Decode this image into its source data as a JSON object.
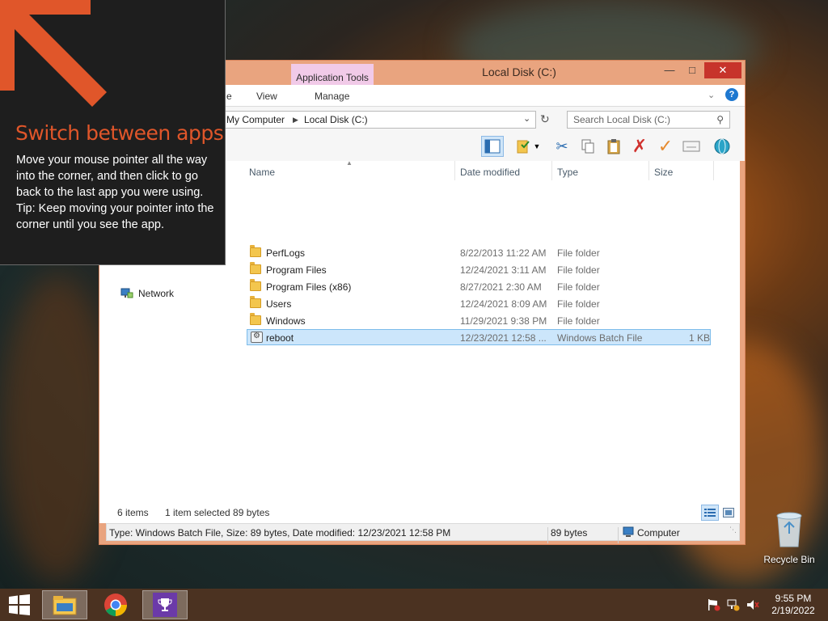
{
  "window": {
    "title": "Local Disk (C:)",
    "contextual_tab": "Application Tools",
    "ribbon_tabs": [
      "e",
      "View",
      "Manage"
    ],
    "breadcrumb": [
      "My Computer",
      "Local Disk (C:)"
    ],
    "search_placeholder": "Search Local Disk (C:)"
  },
  "columns": [
    "Name",
    "Date modified",
    "Type",
    "Size"
  ],
  "files": [
    {
      "name": "PerfLogs",
      "date": "8/22/2013 11:22 AM",
      "type": "File folder",
      "size": "",
      "icon": "folder-icon"
    },
    {
      "name": "Program Files",
      "date": "12/24/2021 3:11 AM",
      "type": "File folder",
      "size": "",
      "icon": "folder-icon"
    },
    {
      "name": "Program Files (x86)",
      "date": "8/27/2021 2:30 AM",
      "type": "File folder",
      "size": "",
      "icon": "folder-icon"
    },
    {
      "name": "Users",
      "date": "12/24/2021 8:09 AM",
      "type": "File folder",
      "size": "",
      "icon": "folder-icon"
    },
    {
      "name": "Windows",
      "date": "11/29/2021 9:38 PM",
      "type": "File folder",
      "size": "",
      "icon": "folder-icon"
    },
    {
      "name": "reboot",
      "date": "12/23/2021 12:58 ...",
      "type": "Windows Batch File",
      "size": "1 KB",
      "icon": "batch-file-icon",
      "selected": true
    }
  ],
  "nav": {
    "network": "Network"
  },
  "status": {
    "items": "6 items",
    "selected": "1 item selected  89 bytes",
    "detail": "Type: Windows Batch File, Size: 89 bytes, Date modified: 12/23/2021 12:58 PM",
    "size": "89 bytes",
    "location": "Computer"
  },
  "tip": {
    "title": "Switch between apps",
    "line1": "Move your mouse pointer all the way into the corner, and then click to go back to the last app you were using.",
    "line2": "Tip: Keep moving your pointer into the corner until you see the app."
  },
  "desktop": {
    "recycle_bin": "Recycle Bin"
  },
  "taskbar": {
    "time": "9:55 PM",
    "date": "2/19/2022"
  },
  "colors": {
    "accent": "#e0562a",
    "window_frame": "#e9a47f",
    "selection": "#cce6fb",
    "taskbar": "#4b3221"
  }
}
